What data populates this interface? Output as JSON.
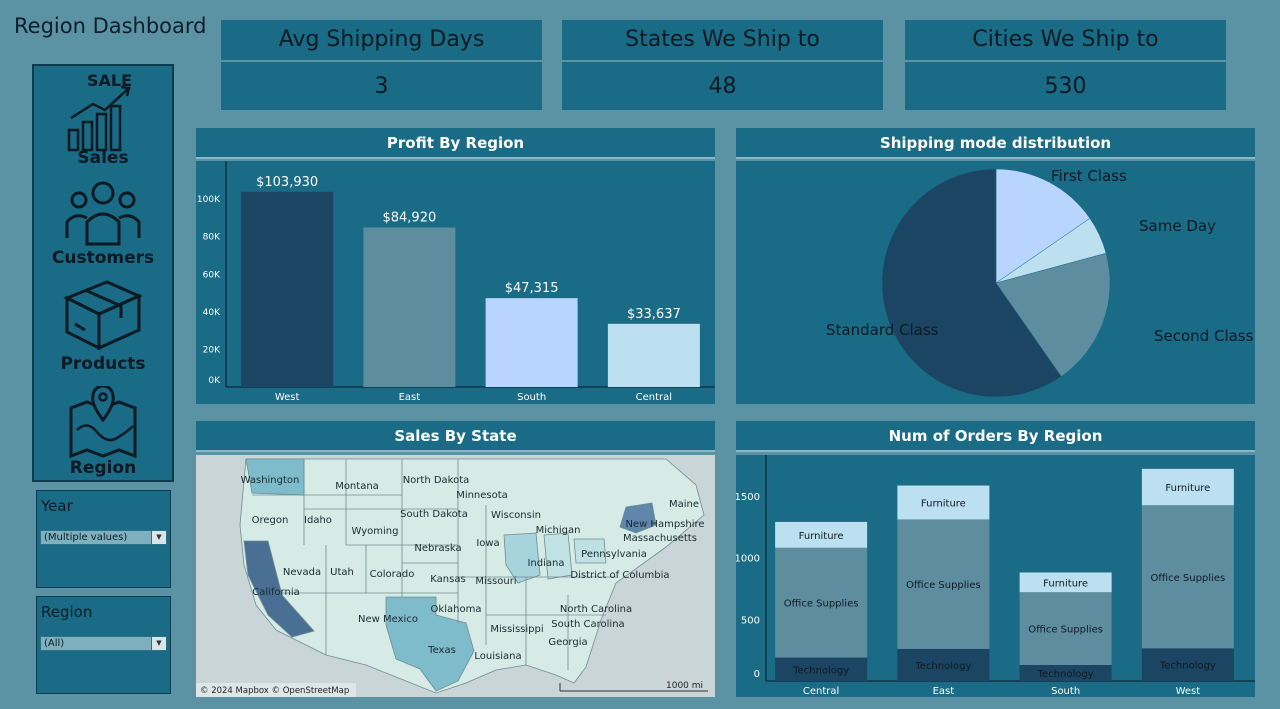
{
  "title": "Region Dashboard",
  "nav": {
    "sales_badge": "SALE",
    "items": [
      {
        "label": "Sales",
        "icon": "sales-chart-icon"
      },
      {
        "label": "Customers",
        "icon": "customers-icon"
      },
      {
        "label": "Products",
        "icon": "box-icon"
      },
      {
        "label": "Region",
        "icon": "map-pin-icon"
      }
    ]
  },
  "filters": {
    "year": {
      "title": "Year",
      "value": "(Multiple values)"
    },
    "region": {
      "title": "Region",
      "value": "(All)"
    }
  },
  "kpis": [
    {
      "label": "Avg Shipping Days",
      "value": "3"
    },
    {
      "label": "States We Ship to",
      "value": "48"
    },
    {
      "label": "Cities We Ship to",
      "value": "530"
    }
  ],
  "panels": {
    "profit": "Profit By Region",
    "shipping": "Shipping mode distribution",
    "sales_state": "Sales By State",
    "orders": "Num of Orders By Region"
  },
  "chart_data": [
    {
      "type": "bar",
      "title": "Profit By Region",
      "categories": [
        "West",
        "East",
        "South",
        "Central"
      ],
      "values": [
        103930,
        84920,
        47315,
        33637
      ],
      "data_labels": [
        "$103,930",
        "$84,920",
        "$47,315",
        "$33,637"
      ],
      "colors": [
        "#1b4563",
        "#5e8d9f",
        "#b7d5ff",
        "#bde0f0"
      ],
      "yticks": [
        "0K",
        "20K",
        "40K",
        "60K",
        "80K",
        "100K"
      ],
      "ylim": [
        0,
        115000
      ]
    },
    {
      "type": "pie",
      "title": "Shipping mode distribution",
      "labels": [
        "First Class",
        "Same Day",
        "Second Class",
        "Standard Class"
      ],
      "values": [
        15.4,
        5.4,
        19.5,
        59.7
      ],
      "colors": [
        "#b7d5ff",
        "#bde0f0",
        "#5e8d9f",
        "#1b4563"
      ]
    },
    {
      "type": "bar",
      "title": "Num of Orders By Region",
      "stacked": true,
      "categories": [
        "Central",
        "East",
        "South",
        "West"
      ],
      "series": [
        {
          "name": "Technology",
          "values": [
            190,
            260,
            130,
            265
          ],
          "color": "#1b4563"
        },
        {
          "name": "Office Supplies",
          "values": [
            890,
            1050,
            590,
            1160
          ],
          "color": "#5e8d9f"
        },
        {
          "name": "Furniture",
          "values": [
            210,
            275,
            160,
            295
          ],
          "color": "#bde0f0"
        }
      ],
      "yticks": [
        "0",
        "500",
        "1000",
        "1500"
      ],
      "ylim": [
        0,
        1800
      ]
    }
  ],
  "map": {
    "states": [
      "Washington",
      "Montana",
      "North Dakota",
      "Minnesota",
      "Maine",
      "Oregon",
      "Idaho",
      "Wyoming",
      "South Dakota",
      "Wisconsin",
      "New Hampshire",
      "Michigan",
      "Massachusetts",
      "Iowa",
      "Nebraska",
      "Nevada",
      "Utah",
      "Colorado",
      "Pennsylvania",
      "Indiana",
      "California",
      "Kansas",
      "Missouri",
      "District of Columbia",
      "Oklahoma",
      "North Carolina",
      "New Mexico",
      "South Carolina",
      "Mississippi",
      "Georgia",
      "Texas",
      "Louisiana"
    ],
    "attribution": "© 2024 Mapbox © OpenStreetMap",
    "scale": "1000 mi"
  }
}
